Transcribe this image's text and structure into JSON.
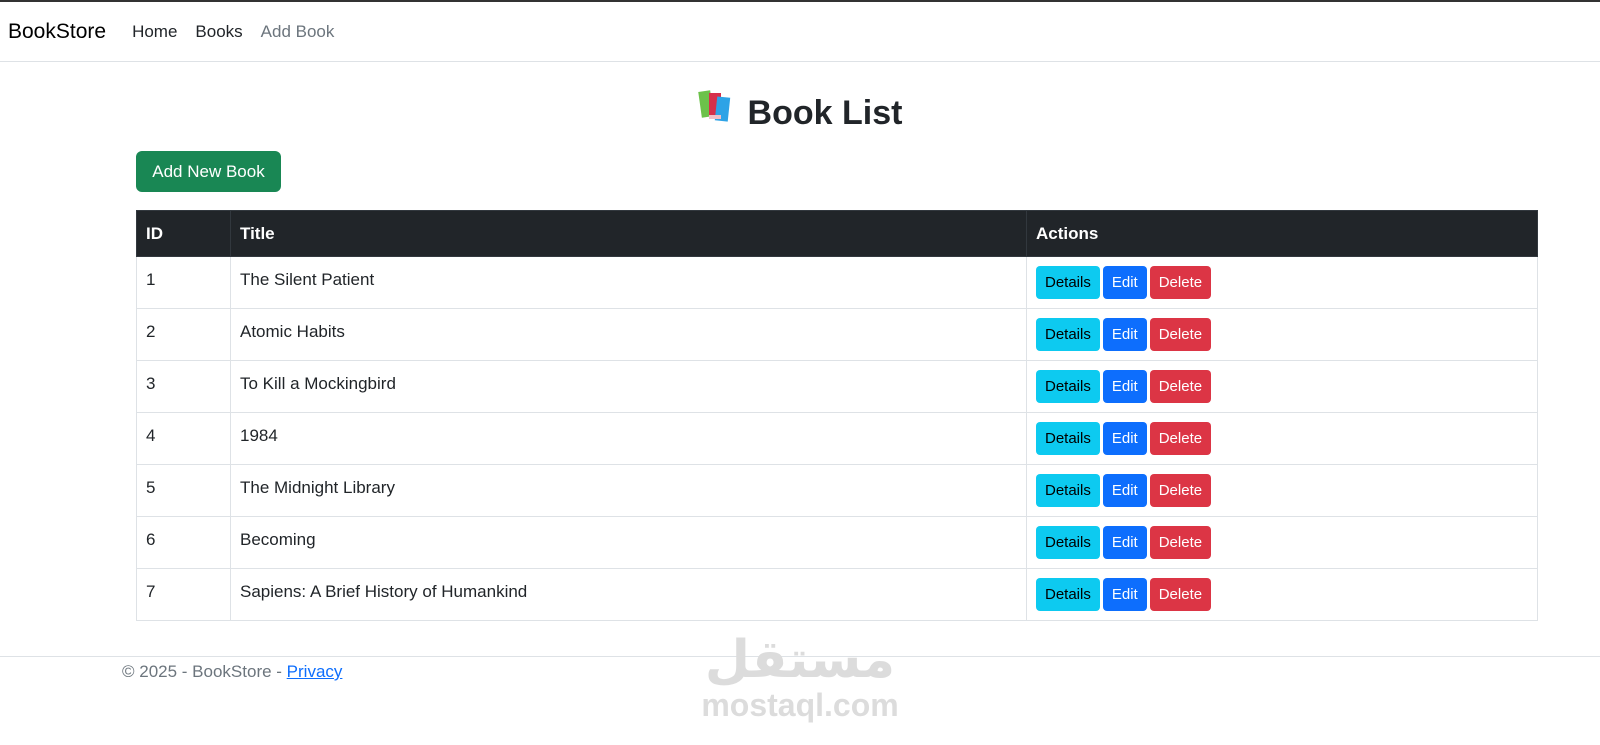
{
  "nav": {
    "brand": "BookStore",
    "links": [
      {
        "label": "Home"
      },
      {
        "label": "Books"
      },
      {
        "label": "Add Book"
      }
    ]
  },
  "page": {
    "title": "Book List",
    "title_icon": "books-icon",
    "add_button": "Add New Book"
  },
  "table": {
    "headers": [
      "ID",
      "Title",
      "Actions"
    ],
    "rows": [
      {
        "id": "1",
        "title": "The Silent Patient"
      },
      {
        "id": "2",
        "title": "Atomic Habits"
      },
      {
        "id": "3",
        "title": "To Kill a Mockingbird"
      },
      {
        "id": "4",
        "title": "1984"
      },
      {
        "id": "5",
        "title": "The Midnight Library"
      },
      {
        "id": "6",
        "title": "Becoming"
      },
      {
        "id": "7",
        "title": "Sapiens: A Brief History of Humankind"
      }
    ],
    "actions": {
      "details": "Details",
      "edit": "Edit",
      "delete": "Delete"
    }
  },
  "footer": {
    "text": "© 2025 - BookStore - ",
    "privacy": "Privacy"
  },
  "watermark": {
    "arabic": "مستقل",
    "latin": "mostaql.com"
  },
  "colors": {
    "success": "#198754",
    "info": "#0dcaf0",
    "primary": "#0d6efd",
    "danger": "#dc3545",
    "dark": "#212529"
  }
}
